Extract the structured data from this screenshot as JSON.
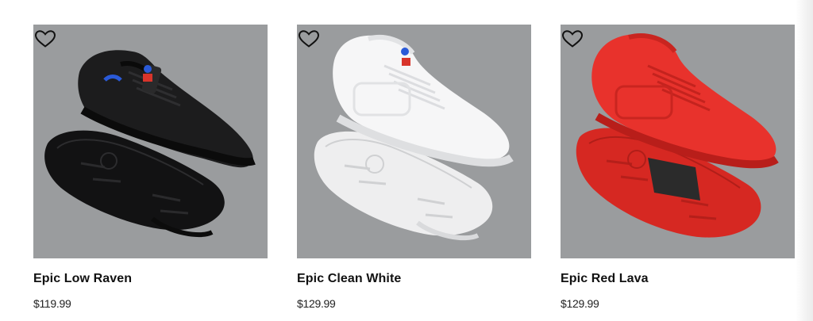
{
  "products": [
    {
      "name": "Epic Low Raven",
      "price": "$119.99",
      "image_icon": "black-sneaker-pair-image",
      "colors": {
        "upper": "#1c1c1d",
        "upper_dark": "#0e0e0f",
        "sole": "#141415",
        "accent": "#2a5ad8"
      }
    },
    {
      "name": "Epic Clean White",
      "price": "$129.99",
      "image_icon": "white-sneaker-pair-image",
      "colors": {
        "upper": "#f6f6f7",
        "upper_dark": "#d9dadc",
        "sole": "#eeeeef",
        "accent": "#d8342b"
      }
    },
    {
      "name": "Epic Red Lava",
      "price": "$129.99",
      "image_icon": "red-sneaker-pair-image",
      "colors": {
        "upper": "#e8322c",
        "upper_dark": "#b81e1a",
        "sole": "#d62822",
        "accent": "#2b2b2b"
      }
    }
  ],
  "image_background": "#9a9c9e",
  "wishlist_icon": "heart-outline-icon"
}
